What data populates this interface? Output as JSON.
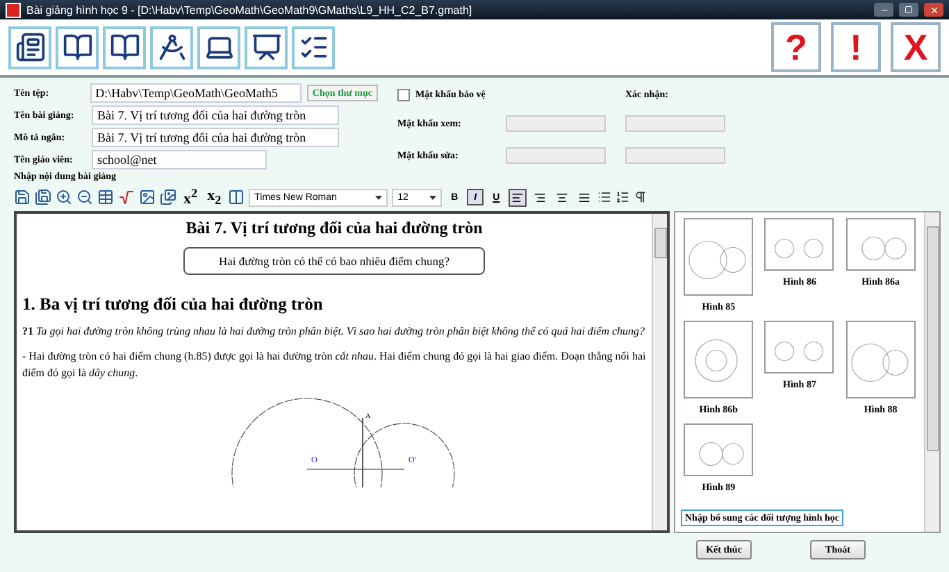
{
  "window": {
    "title": "Bài giảng hình học 9 - [D:\\Habv\\Temp\\GeoMath\\GeoMath9\\GMaths\\L9_HH_C2_B7.gmath]"
  },
  "toolbar": {
    "tools": [
      {
        "kind": "contents"
      },
      {
        "kind": "book"
      },
      {
        "kind": "book"
      },
      {
        "kind": "compass"
      },
      {
        "kind": "laptop"
      },
      {
        "kind": "board"
      },
      {
        "kind": "checklist"
      }
    ],
    "actions": [
      {
        "label": "?"
      },
      {
        "label": "!"
      },
      {
        "label": "X"
      }
    ]
  },
  "form": {
    "file": {
      "label": "Tên tệp:",
      "value": "D:\\Habv\\Temp\\GeoMath\\GeoMath5",
      "button": "Chọn thư mục"
    },
    "fields": [
      {
        "label": "Tên bài giảng:",
        "value": "Bài 7. Vị trí tương đối của hai đường tròn"
      },
      {
        "label": "Mô tả ngắn:",
        "value": "Bài 7. Vị trí tương đối của hai đường tròn"
      },
      {
        "label": "Tên giáo viên:",
        "value": "school@net"
      }
    ],
    "password": {
      "label": "Mật khẩu bảo vệ",
      "checked": false,
      "confirm_label": "Xác nhận:",
      "rows": [
        {
          "label": "Mật khẩu xem:",
          "disabled": true
        },
        {
          "label": "Mật khẩu sửa:",
          "disabled": true
        }
      ]
    }
  },
  "editor": {
    "label": "Nhập nội dung bài giảng",
    "scripts": [
      "x$^{2}$",
      "x$_{2}$"
    ],
    "font": "Times New Roman",
    "size": "12",
    "styles": [
      {
        "label": "B",
        "selected": false
      },
      {
        "label": "I",
        "selected": true
      },
      {
        "label": "U",
        "selected": false
      }
    ],
    "alignment": [
      {
        "kind": "left",
        "selected": true
      },
      {
        "kind": "right",
        "selected": false
      },
      {
        "kind": "center",
        "selected": false
      },
      {
        "kind": "justify",
        "selected": false
      }
    ],
    "document": {
      "title": "Bài 7. Vị trí tương đối của hai đường tròn",
      "question_box": "Hai đường tròn có thể có bao nhiêu điểm chung?",
      "heading": "1. Ba vị trí tương đối của hai đường tròn",
      "question": "**?1** *Ta gọi hai đường tròn không trùng nhau là hai đường tròn phân biệt. Vì sao hai đường tròn phân biệt không thể có quá hai điểm chung?*",
      "paragraph": "- Hai đường tròn có hai điểm chung (h.85) được gọi là hai đường tròn *cắt nhau*. Hai điểm chung đó gọi là hai giao điểm. Đoạn thẳng nối hai điểm đó gọi là *dây chung*.",
      "figure_labels": [
        "A",
        "O",
        "O'"
      ]
    }
  },
  "gallery": {
    "figures": [
      {
        "caption": "Hình 85",
        "kind": "cut"
      },
      {
        "caption": "Hình 86",
        "kind": "apart"
      },
      {
        "caption": "Hình 86a",
        "kind": "touch"
      },
      {
        "caption": "Hình 86b",
        "kind": "inside"
      },
      {
        "caption": "Hình 87",
        "kind": "apart"
      },
      {
        "caption": "Hình 88",
        "kind": "cut"
      },
      {
        "caption": "Hình 89",
        "kind": "touch"
      }
    ],
    "add_button": "Nhập bổ sung các đối tượng hình học"
  },
  "buttons": [
    "Kết thúc",
    "Thoát"
  ]
}
